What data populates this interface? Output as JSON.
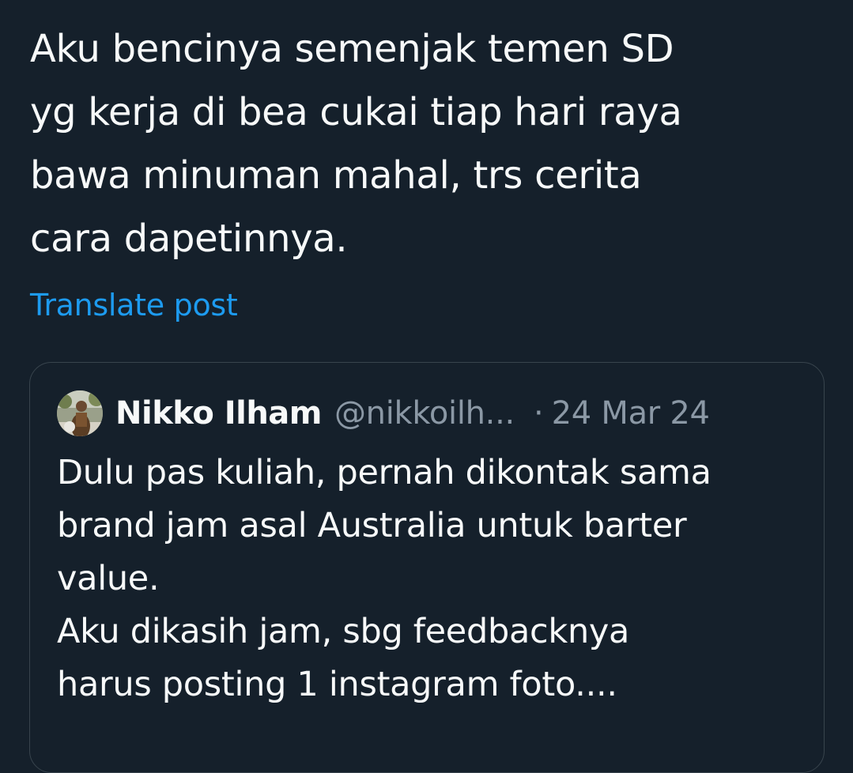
{
  "post": {
    "text": "Aku bencinya semenjak temen SD\nyg kerja di bea cukai tiap hari raya\nbawa minuman mahal, trs cerita\ncara dapetinnya.",
    "translate_label": "Translate post"
  },
  "quoted_post": {
    "author_name": "Nikko Ilham",
    "author_handle": "@nikkoilh...",
    "separator": "·",
    "date": "24 Mar 24",
    "text": "Dulu pas kuliah, pernah dikontak sama\nbrand jam asal Australia untuk barter\nvalue.\nAku dikasih jam, sbg feedbacknya\nharus posting 1 instagram foto....",
    "avatar_icon": "profile-photo-avatar"
  },
  "colors": {
    "background": "#15202b",
    "text_primary": "#f7f9f9",
    "text_secondary": "#8b98a5",
    "link": "#1d9bf0",
    "border": "#38444d"
  }
}
